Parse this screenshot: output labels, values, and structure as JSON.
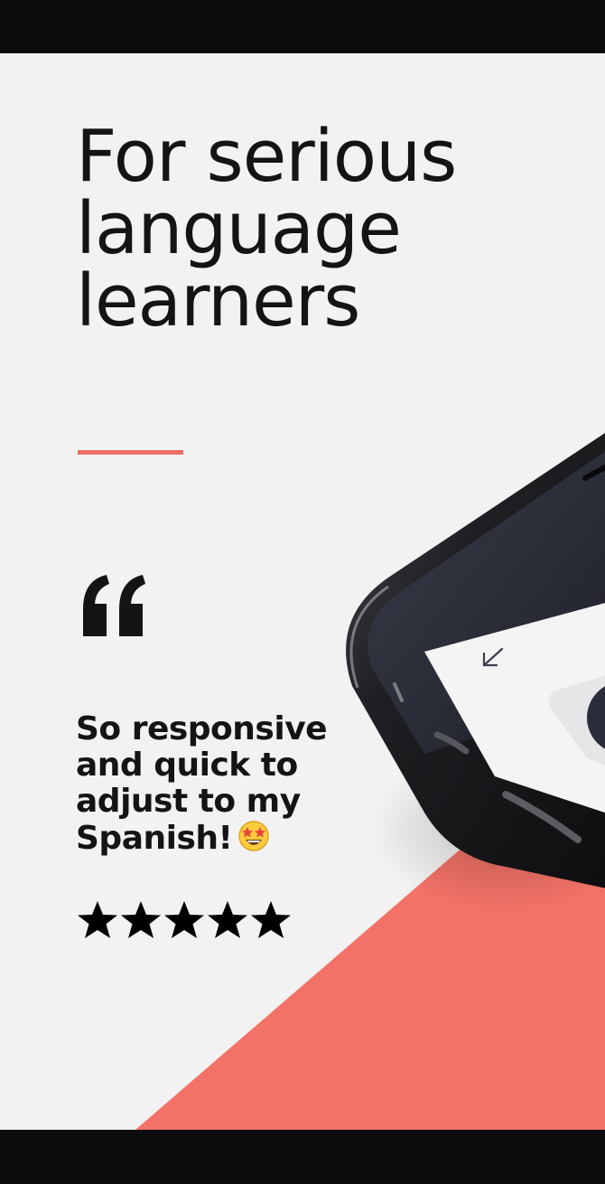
{
  "hero": {
    "headline": "For serious\nlanguage\nlearners"
  },
  "testimonial": {
    "quote_mark_icon": "open-quote-icon",
    "text": "So responsive and quick to adjust to my Spanish!",
    "emoji_icon": "star-struck-emoji-icon"
  },
  "rating": {
    "stars": 5,
    "max_stars": 5,
    "star_icon": "star-icon"
  },
  "colors": {
    "background": "#f2f2f2",
    "accent": "#f06d63",
    "text": "#141414",
    "frame": "#0c0c0c",
    "phone_body": "#1b1c1e"
  },
  "phone_screen": {
    "back_icon": "arrow-down-left-icon"
  }
}
